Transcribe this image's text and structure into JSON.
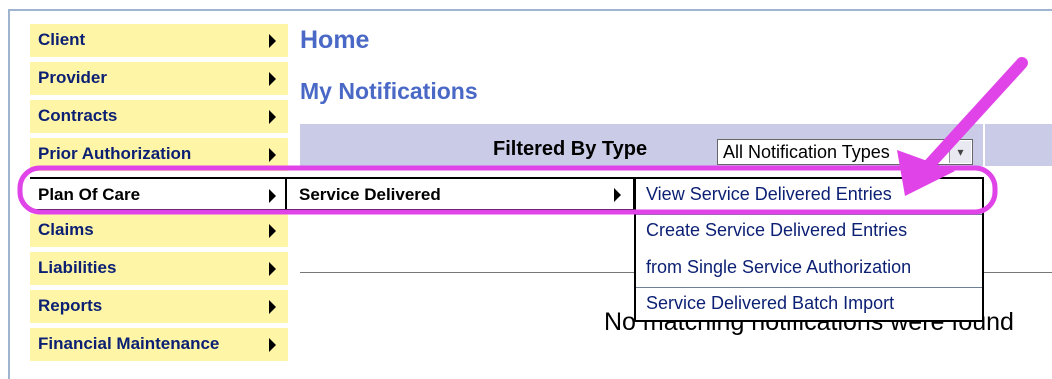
{
  "menu": {
    "items": [
      {
        "label": "Client"
      },
      {
        "label": "Provider"
      },
      {
        "label": "Contracts"
      },
      {
        "label": "Prior Authorization"
      },
      {
        "label": "Plan Of Care"
      },
      {
        "label": "Claims"
      },
      {
        "label": "Liabilities"
      },
      {
        "label": "Reports"
      },
      {
        "label": "Financial Maintenance"
      }
    ]
  },
  "submenu": {
    "label": "Service Delivered"
  },
  "submenu2": {
    "items": [
      {
        "label": "View Service Delivered Entries"
      },
      {
        "label": "Create Service Delivered Entries"
      },
      {
        "label": "from Single Service Authorization"
      },
      {
        "label": "Service Delivered Batch Import"
      }
    ]
  },
  "page": {
    "title": "Home",
    "subtitle": "My Notifications"
  },
  "filter": {
    "label": "Filtered By Type",
    "selected": "All Notification Types"
  },
  "content": {
    "empty_message": "No matching notifications were found"
  },
  "colors": {
    "menu_bg": "#fff5a6",
    "menu_text": "#0b1f73",
    "heading": "#4a68c5",
    "filter_bar": "#c9cbe7",
    "annotation": "#e043e8"
  }
}
